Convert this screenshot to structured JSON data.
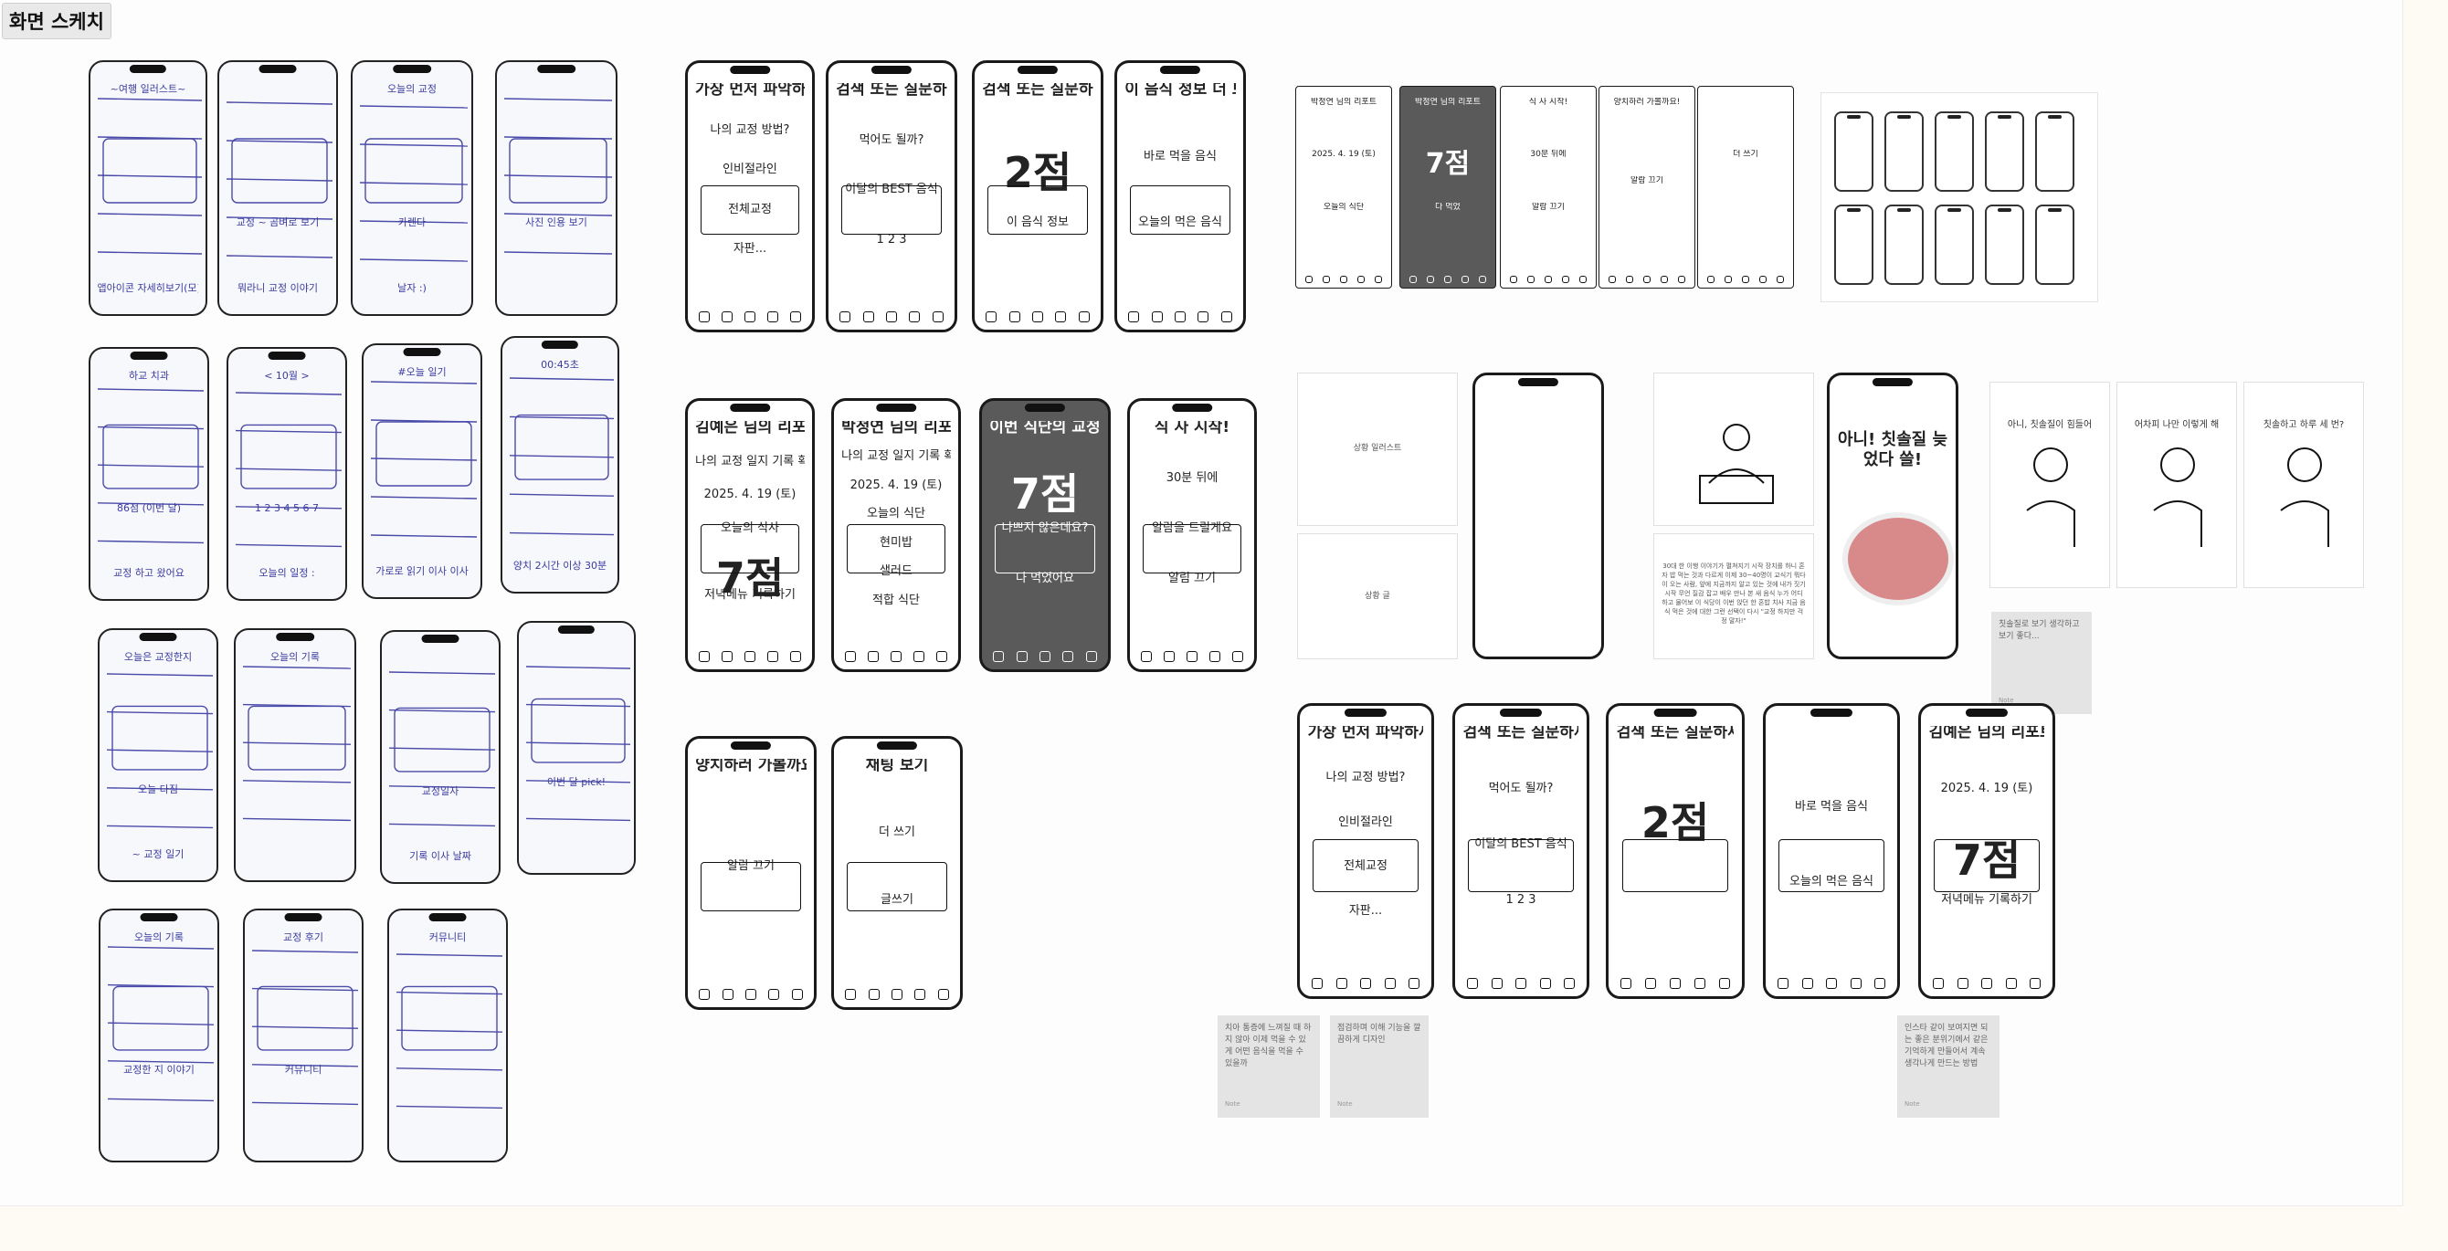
{
  "frame": {
    "title": "화면 스케치"
  },
  "photo_sketches": [
    {
      "texts": [
        "~여행 일러스트~",
        "",
        "앱아이콘 자세히보기(모)모얼"
      ]
    },
    {
      "texts": [
        "",
        "교정 ~ 곰벼로 보기",
        "뭐라니 교정 이야기"
      ]
    },
    {
      "texts": [
        "오늘의 교정",
        "카렌다",
        "날자 :)"
      ]
    },
    {
      "texts": [
        "",
        "사진 인용 보기",
        ""
      ]
    },
    {
      "texts": [
        "하교 치과",
        "86점 (이번 달)",
        "교정 하고 왔어요"
      ]
    },
    {
      "texts": [
        "< 10월 >",
        "1 2 3 4 5 6 7",
        "오늘의 일정 :"
      ]
    },
    {
      "texts": [
        "#오늘 일기",
        "",
        "가로로 읽기 이사 이사"
      ]
    },
    {
      "texts": [
        "00:45초",
        "",
        "양치 2시간 이상 30분"
      ]
    },
    {
      "texts": [
        "오늘은 교정한지",
        "오늘 다짐",
        "~ 교정 일기"
      ]
    },
    {
      "texts": [
        "오늘의 기록",
        "",
        ""
      ]
    },
    {
      "texts": [
        "",
        "교정일자",
        "기록 이사 날짜"
      ]
    },
    {
      "texts": [
        "",
        "이번 달 pick!",
        ""
      ]
    },
    {
      "texts": [
        "오늘의 기록",
        "교정한 지 이야기",
        ""
      ]
    },
    {
      "texts": [
        "교정 후기",
        "커뮤니티",
        ""
      ]
    },
    {
      "texts": [
        "커뮤니티",
        "",
        ""
      ]
    }
  ],
  "ink_sketches_a": [
    {
      "texts": [
        "가장 먼저 파악하세요!",
        "나의 교정 방법?",
        "인비절라인",
        "전체교정",
        "자판..."
      ]
    },
    {
      "texts": [
        "검색 또는 질문하세요",
        "먹어도 될까?",
        "이달의 BEST 음식",
        "1  2  3"
      ]
    },
    {
      "texts": [
        "검색 또는 질문하세요",
        "2점",
        "이 음식 정보"
      ]
    },
    {
      "texts": [
        "이 음식 정보 더 보기",
        "바로 먹을 음식",
        "오늘의 먹은 음식"
      ]
    }
  ],
  "ink_sketches_b": [
    {
      "texts": [
        "김예은 님의 리포트",
        "나의 교정 일지 기록 확인하기",
        "2025. 4. 19 (토)",
        "오늘의 식사",
        "7점",
        "저녁메뉴 기록하기"
      ]
    },
    {
      "texts": [
        "박정연 님의 리포트",
        "나의 교정 일지 기록 확인하기",
        "2025. 4. 19 (토)",
        "오늘의 식단",
        "현미밥",
        "샐러드",
        "적합 식단"
      ]
    },
    {
      "texts": [
        "이번 식단의 교정점수는",
        "7점",
        "나쁘지 않은데요?",
        "다 먹었어요"
      ]
    },
    {
      "texts": [
        "식 사 시작!",
        "30분 뒤에",
        "알람을 드릴게요",
        "알림 끄기"
      ]
    }
  ],
  "ink_sketches_c": [
    {
      "texts": [
        "양치하러 가볼까요!",
        "알람 끄기"
      ]
    },
    {
      "texts": [
        "채팅 보기",
        "더 쓰기",
        "글쓰기"
      ]
    }
  ],
  "ui_screens": [
    {
      "texts": [
        "박정연 님의 리포트",
        "2025. 4. 19 (토)",
        "오늘의 식단"
      ],
      "dark": false
    },
    {
      "texts": [
        "박정연 님의 리포트",
        "7점",
        "다 먹었"
      ],
      "dark": true
    },
    {
      "texts": [
        "식 사 시작!",
        "30분 뒤에",
        "알람 끄기"
      ],
      "dark": false
    },
    {
      "texts": [
        "양치하러 가볼까요!",
        "알람 끄기"
      ],
      "dark": false
    },
    {
      "texts": [
        "",
        "더 쓰기",
        ""
      ],
      "dark": false
    }
  ],
  "tiles": {
    "scenario_title": "상황 일러스트",
    "scenario_sub": "상황 글",
    "description": "30대 한 이행 이야기가 펼쳐지기 시작 장치를 하니 혼자 밥 먹는 것과 다르게 이제 30~40명이 교식기 뭐다 이 오는 사람, 앞에 지금까지 알고 있는 것에 내가 짓기 시작 무언 질감 잡고 배우 만나 본 새 음식 누가 어디 하고 물어보 이 식당이 이번 앉던 한 혼밥 치사 지금 음식 먹은 것에 대한 그런 선택이 다시 \"교정 하지만 걱정 말자!\"",
    "teeth_title": "아니! 칫솔질 늦었다 쓸!",
    "illustrations": [
      "아니, 칫솔질이 힘들어",
      "어차피 나만 이렇게 해",
      "칫솔하고 하루 세 번?"
    ]
  },
  "notes": [
    {
      "text": "칫솔질로 보기 생각하고 보기 좋다...",
      "tag": "Note"
    },
    {
      "text": "치아 통증에 느껴질 때 하지 않아 이제 먹을 수 있게 어떤 음식을 먹을 수 있을까",
      "tag": "Note"
    },
    {
      "text": "점검하며 이해 기능을 깔끔하게 디자인",
      "tag": "Note"
    },
    {
      "text": "인스타 같이 보여지면 되는 좋은 분위기에서 같은 기억하게 만들어서 계속 생각나게 만드는 방법",
      "tag": "Note"
    }
  ],
  "bottom_row": [
    {
      "texts": [
        "가장 먼저 파악하세요!",
        "나의 교정 방법?",
        "인비절라인",
        "전체교정",
        "자판..."
      ]
    },
    {
      "texts": [
        "검색 또는 질문하세요",
        "먹어도 될까?",
        "이달의 BEST 음식",
        "1  2  3"
      ]
    },
    {
      "texts": [
        "검색 또는 질문하세요",
        "2점",
        ""
      ]
    },
    {
      "texts": [
        "",
        "바로 먹을 음식",
        "오늘의 먹은 음식"
      ]
    },
    {
      "texts": [
        "김예은 님의 리포트",
        "2025. 4. 19 (토)",
        "7점",
        "저녁메뉴 기록하기"
      ]
    }
  ],
  "colors": {
    "canvas": "#fdfdfd",
    "ink": "#111111",
    "pencil": "#4a4aa8",
    "note": "#e4e4e4"
  }
}
